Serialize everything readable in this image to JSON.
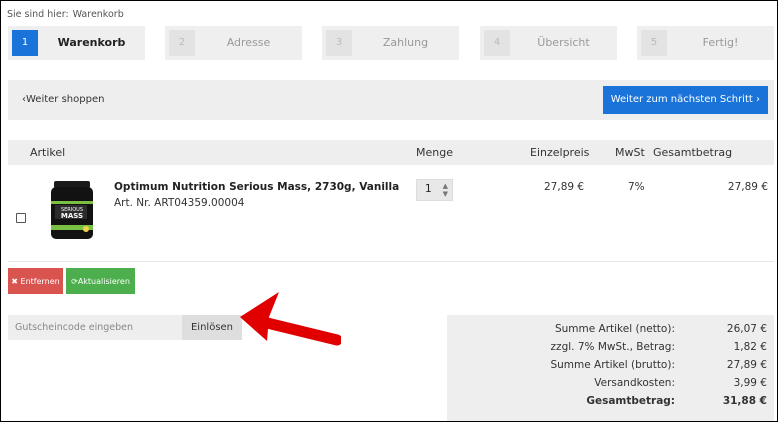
{
  "breadcrumb": {
    "prefix": "Sie sind hier:",
    "current": "Warenkorb"
  },
  "steps": [
    {
      "num": "1",
      "label": "Warenkorb",
      "active": true
    },
    {
      "num": "2",
      "label": "Adresse"
    },
    {
      "num": "3",
      "label": "Zahlung"
    },
    {
      "num": "4",
      "label": "Übersicht"
    },
    {
      "num": "5",
      "label": "Fertig!"
    }
  ],
  "nav": {
    "back": "Weiter shoppen",
    "next": "Weiter zum nächsten Schritt"
  },
  "table": {
    "headers": {
      "article": "Artikel",
      "quantity": "Menge",
      "unit_price": "Einzelpreis",
      "vat": "MwSt",
      "total": "Gesamtbetrag"
    },
    "rows": [
      {
        "name": "Optimum Nutrition Serious Mass, 2730g, Vanilla",
        "art_nr": "Art. Nr. ART04359.00004",
        "quantity": "1",
        "unit_price": "27,89 €",
        "vat": "7%",
        "total": "27,89 €",
        "image_text": [
          "SERIOUS",
          "MASS"
        ]
      }
    ]
  },
  "actions": {
    "remove": "Entfernen",
    "update": "Aktualisieren"
  },
  "coupon": {
    "placeholder": "Gutscheincode eingeben",
    "value": "",
    "button": "Einlösen"
  },
  "summary": [
    {
      "label": "Summe Artikel (netto):",
      "value": "26,07 €"
    },
    {
      "label": "zzgl. 7% MwSt., Betrag:",
      "value": "1,82 €"
    },
    {
      "label": "Summe Artikel (brutto):",
      "value": "27,89 €"
    },
    {
      "label": "Versandkosten:",
      "value": "3,99 €"
    },
    {
      "label": "Gesamtbetrag:",
      "value": "31,88 €",
      "bold": true
    }
  ],
  "colors": {
    "primary": "#1a73d9",
    "danger": "#d9534f",
    "success": "#4cae4c",
    "annotation_arrow": "#e00000"
  },
  "icons": {
    "back": "chevron-left-icon",
    "next": "chevron-right-icon",
    "remove": "x-icon",
    "update": "refresh-icon",
    "spinner": "up-down-arrows-icon"
  }
}
